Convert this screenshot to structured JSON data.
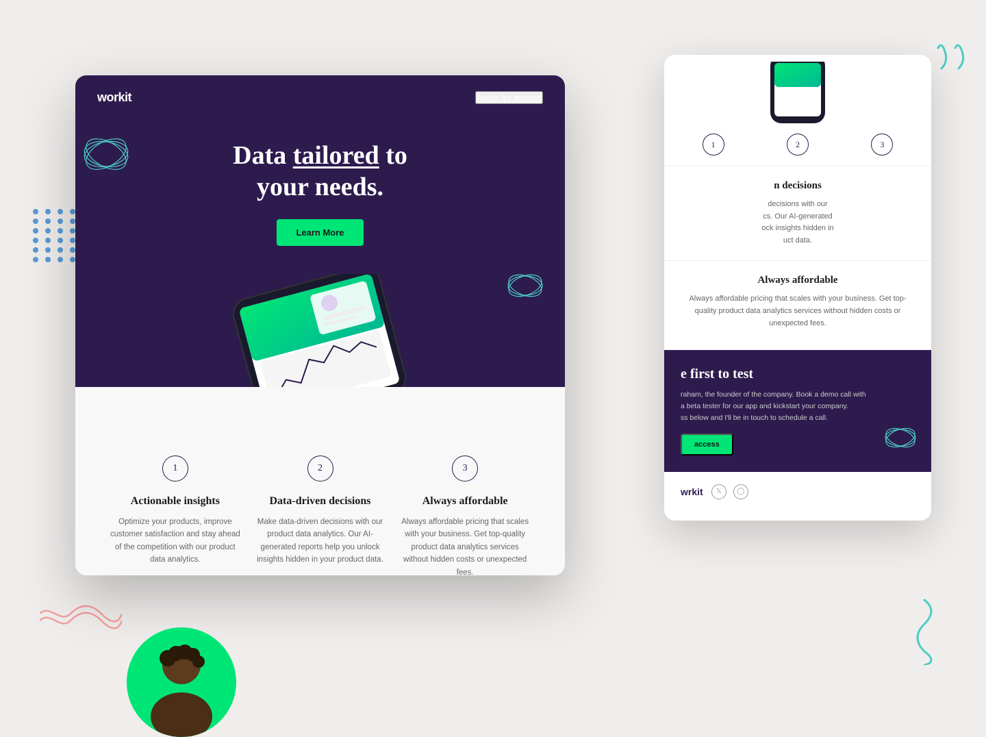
{
  "brand": {
    "logo_text": "work",
    "logo_bold": "it"
  },
  "nav": {
    "cta_label": "Apply for access"
  },
  "hero": {
    "title_line1": "Data ",
    "title_underline": "tailored",
    "title_line1_end": " to",
    "title_line2": "your needs.",
    "cta_button": "Learn More"
  },
  "features": [
    {
      "number": "1",
      "title": "Actionable insights",
      "description": "Optimize your products, improve customer satisfaction and stay ahead of the competition with our product data analytics."
    },
    {
      "number": "2",
      "title": "Data-driven decisions",
      "description": "Make data-driven decisions with our product data analytics. Our AI-generated reports help you unlock insights hidden in your product data."
    },
    {
      "number": "3",
      "title": "Always affordable",
      "description": "Always affordable pricing that scales with your business. Get top-quality product data analytics services without hidden costs or unexpected fees."
    }
  ],
  "secondary_window": {
    "feature_numbers": [
      "1",
      "2",
      "3"
    ],
    "feature_partial_title": "n decisions",
    "feature_partial_desc": "decisions with our\ncs. Our AI-generated\nock insights hidden in\nuct data.",
    "always_affordable_title": "Always affordable",
    "always_affordable_desc": "Always affordable pricing that scales with your business. Get top-quality product data analytics services without hidden costs or unexpected fees.",
    "cta_section": {
      "title": "e first to test",
      "description": "raham, the founder of the company. Book a demo call with\na beta tester for our app and kickstart your company.\nss below and I'll be in touch to schedule a call.",
      "button_label": "access"
    },
    "footer": {
      "logo_text": "rkit",
      "logo_bold_prefix": "w"
    }
  },
  "colors": {
    "dark_purple": "#2d1b4e",
    "green": "#00e676",
    "teal": "#4ecdc4",
    "light_teal": "#5bc8c0",
    "blue_dots": "#5b9bd5",
    "pink": "#f4a0a0",
    "bg": "#f0eeec"
  },
  "decorations": {
    "teal_circles": "teal-circle-decoration",
    "blue_dots_grid": "5x5 blue dots",
    "pink_wave": "wavy pink line",
    "teal_curly_tr": "teal double-comma top right",
    "teal_curly_br": "teal curly bracket bottom right"
  }
}
